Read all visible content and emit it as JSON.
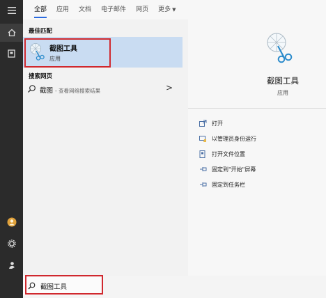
{
  "tabs": [
    {
      "label": "全部",
      "active": true
    },
    {
      "label": "应用",
      "active": false
    },
    {
      "label": "文档",
      "active": false
    },
    {
      "label": "电子邮件",
      "active": false
    },
    {
      "label": "网页",
      "active": false
    },
    {
      "label": "更多",
      "active": false,
      "has_caret": true
    }
  ],
  "rail": {
    "icons": [
      "hamburger-menu-icon",
      "home-icon",
      "document-icon",
      "avatar-icon",
      "settings-gear-icon",
      "user-icon"
    ]
  },
  "results": {
    "best_match_header": "最佳匹配",
    "best_match": {
      "title": "截图工具",
      "subtitle": "应用",
      "icon": "snipping-tool-icon"
    },
    "web_header": "搜索网页",
    "web_result": {
      "query": "截图",
      "hint": "- 查看网络搜索结果",
      "arrow": ">"
    }
  },
  "detail": {
    "title": "截图工具",
    "subtitle": "应用",
    "actions": [
      {
        "label": "打开",
        "icon": "open-icon"
      },
      {
        "label": "以管理员身份运行",
        "icon": "run-as-admin-icon"
      },
      {
        "label": "打开文件位置",
        "icon": "file-location-icon"
      },
      {
        "label": "固定到\"开始\"屏幕",
        "icon": "pin-start-icon"
      },
      {
        "label": "固定到任务栏",
        "icon": "pin-taskbar-icon"
      }
    ]
  },
  "search": {
    "typed": "截图",
    "completion": "工具"
  },
  "colors": {
    "accent": "#2a6ae0",
    "selection": "#c9dcf2",
    "highlight_box": "#d0282e",
    "rail": "#2b2b2b"
  }
}
